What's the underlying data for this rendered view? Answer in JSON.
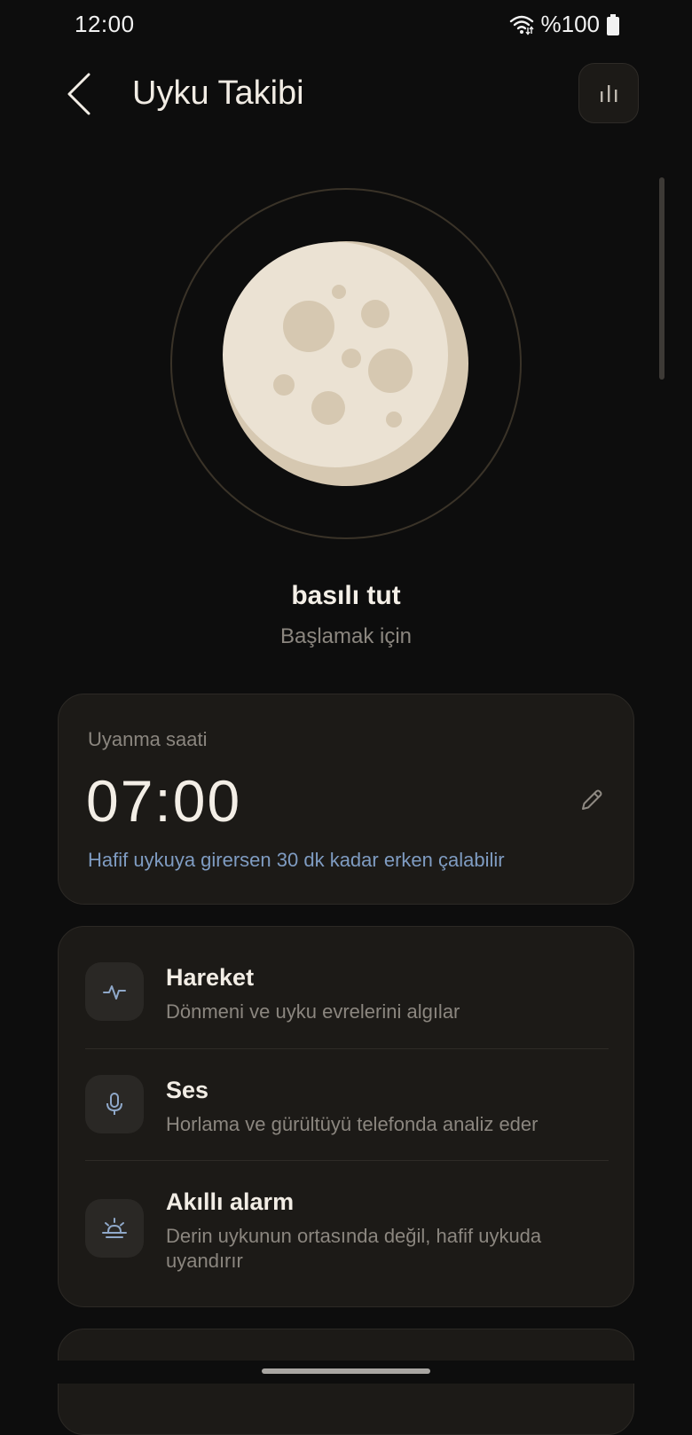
{
  "status_bar": {
    "time": "12:00",
    "battery_text": "%100",
    "icons": [
      "wifi-icon",
      "battery-icon"
    ]
  },
  "app_bar": {
    "title": "Uyku Takibi",
    "back_icon": "back-arrow-icon",
    "stats_icon": "bar-chart-icon"
  },
  "start": {
    "title": "basılı tut",
    "subtitle": "Başlamak için"
  },
  "wake": {
    "label": "Uyanma saati",
    "time": "07:00",
    "hint": "Hafif uykuya girersen 30 dk kadar erken çalabilir",
    "edit_icon": "pencil-icon"
  },
  "features": [
    {
      "icon": "pulse-icon",
      "title": "Hareket",
      "description": "Dönmeni ve uyku evrelerini algılar"
    },
    {
      "icon": "microphone-icon",
      "title": "Ses",
      "description": "Horlama ve gürültüyü telefonda analiz eder"
    },
    {
      "icon": "sunrise-icon",
      "title": "Akıllı alarm",
      "description": "Derin uykunun ortasında değil, hafif uykuda uyandırır"
    }
  ],
  "colors": {
    "background": "#0d0d0d",
    "card": "#1c1a17",
    "accent_blue": "#7f9cc2",
    "moon": "#ebe2d3",
    "moon_shadow": "#d6c8b1"
  }
}
